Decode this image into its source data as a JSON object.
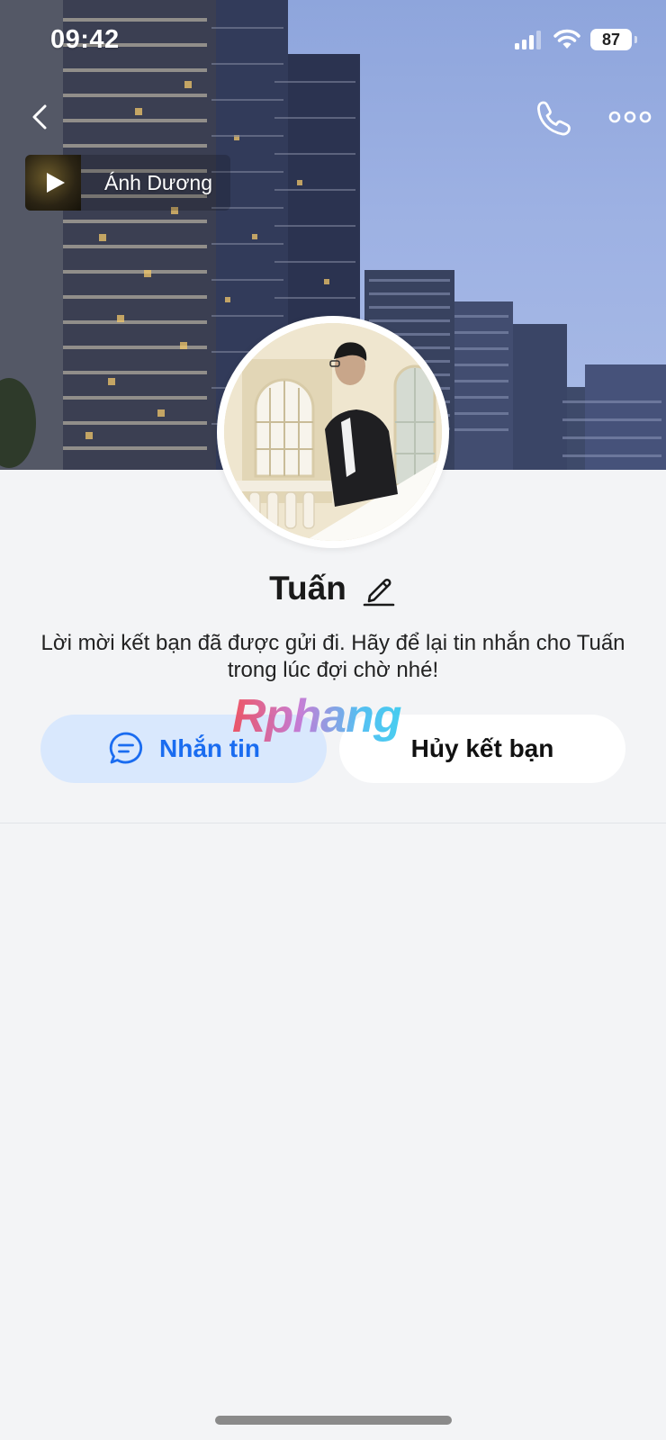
{
  "status_bar": {
    "time": "09:42",
    "battery": "87"
  },
  "nav": {
    "back_icon": "chevron-left-icon",
    "call_icon": "phone-icon",
    "more_icon": "more-dots-icon"
  },
  "music": {
    "title": "Ánh Dương"
  },
  "profile": {
    "name": "Tuấn",
    "invite_message": "Lời mời kết bạn đã được gửi đi. Hãy để lại tin nhắn cho Tuấn trong lúc đợi chờ nhé!"
  },
  "actions": {
    "message_label": "Nhắn tin",
    "unfriend_label": "Hủy kết bạn"
  },
  "watermark": "Rphang",
  "colors": {
    "accent": "#1a6cf0",
    "message_button_bg": "#d9e8fd",
    "page_bg": "#f3f4f6"
  }
}
